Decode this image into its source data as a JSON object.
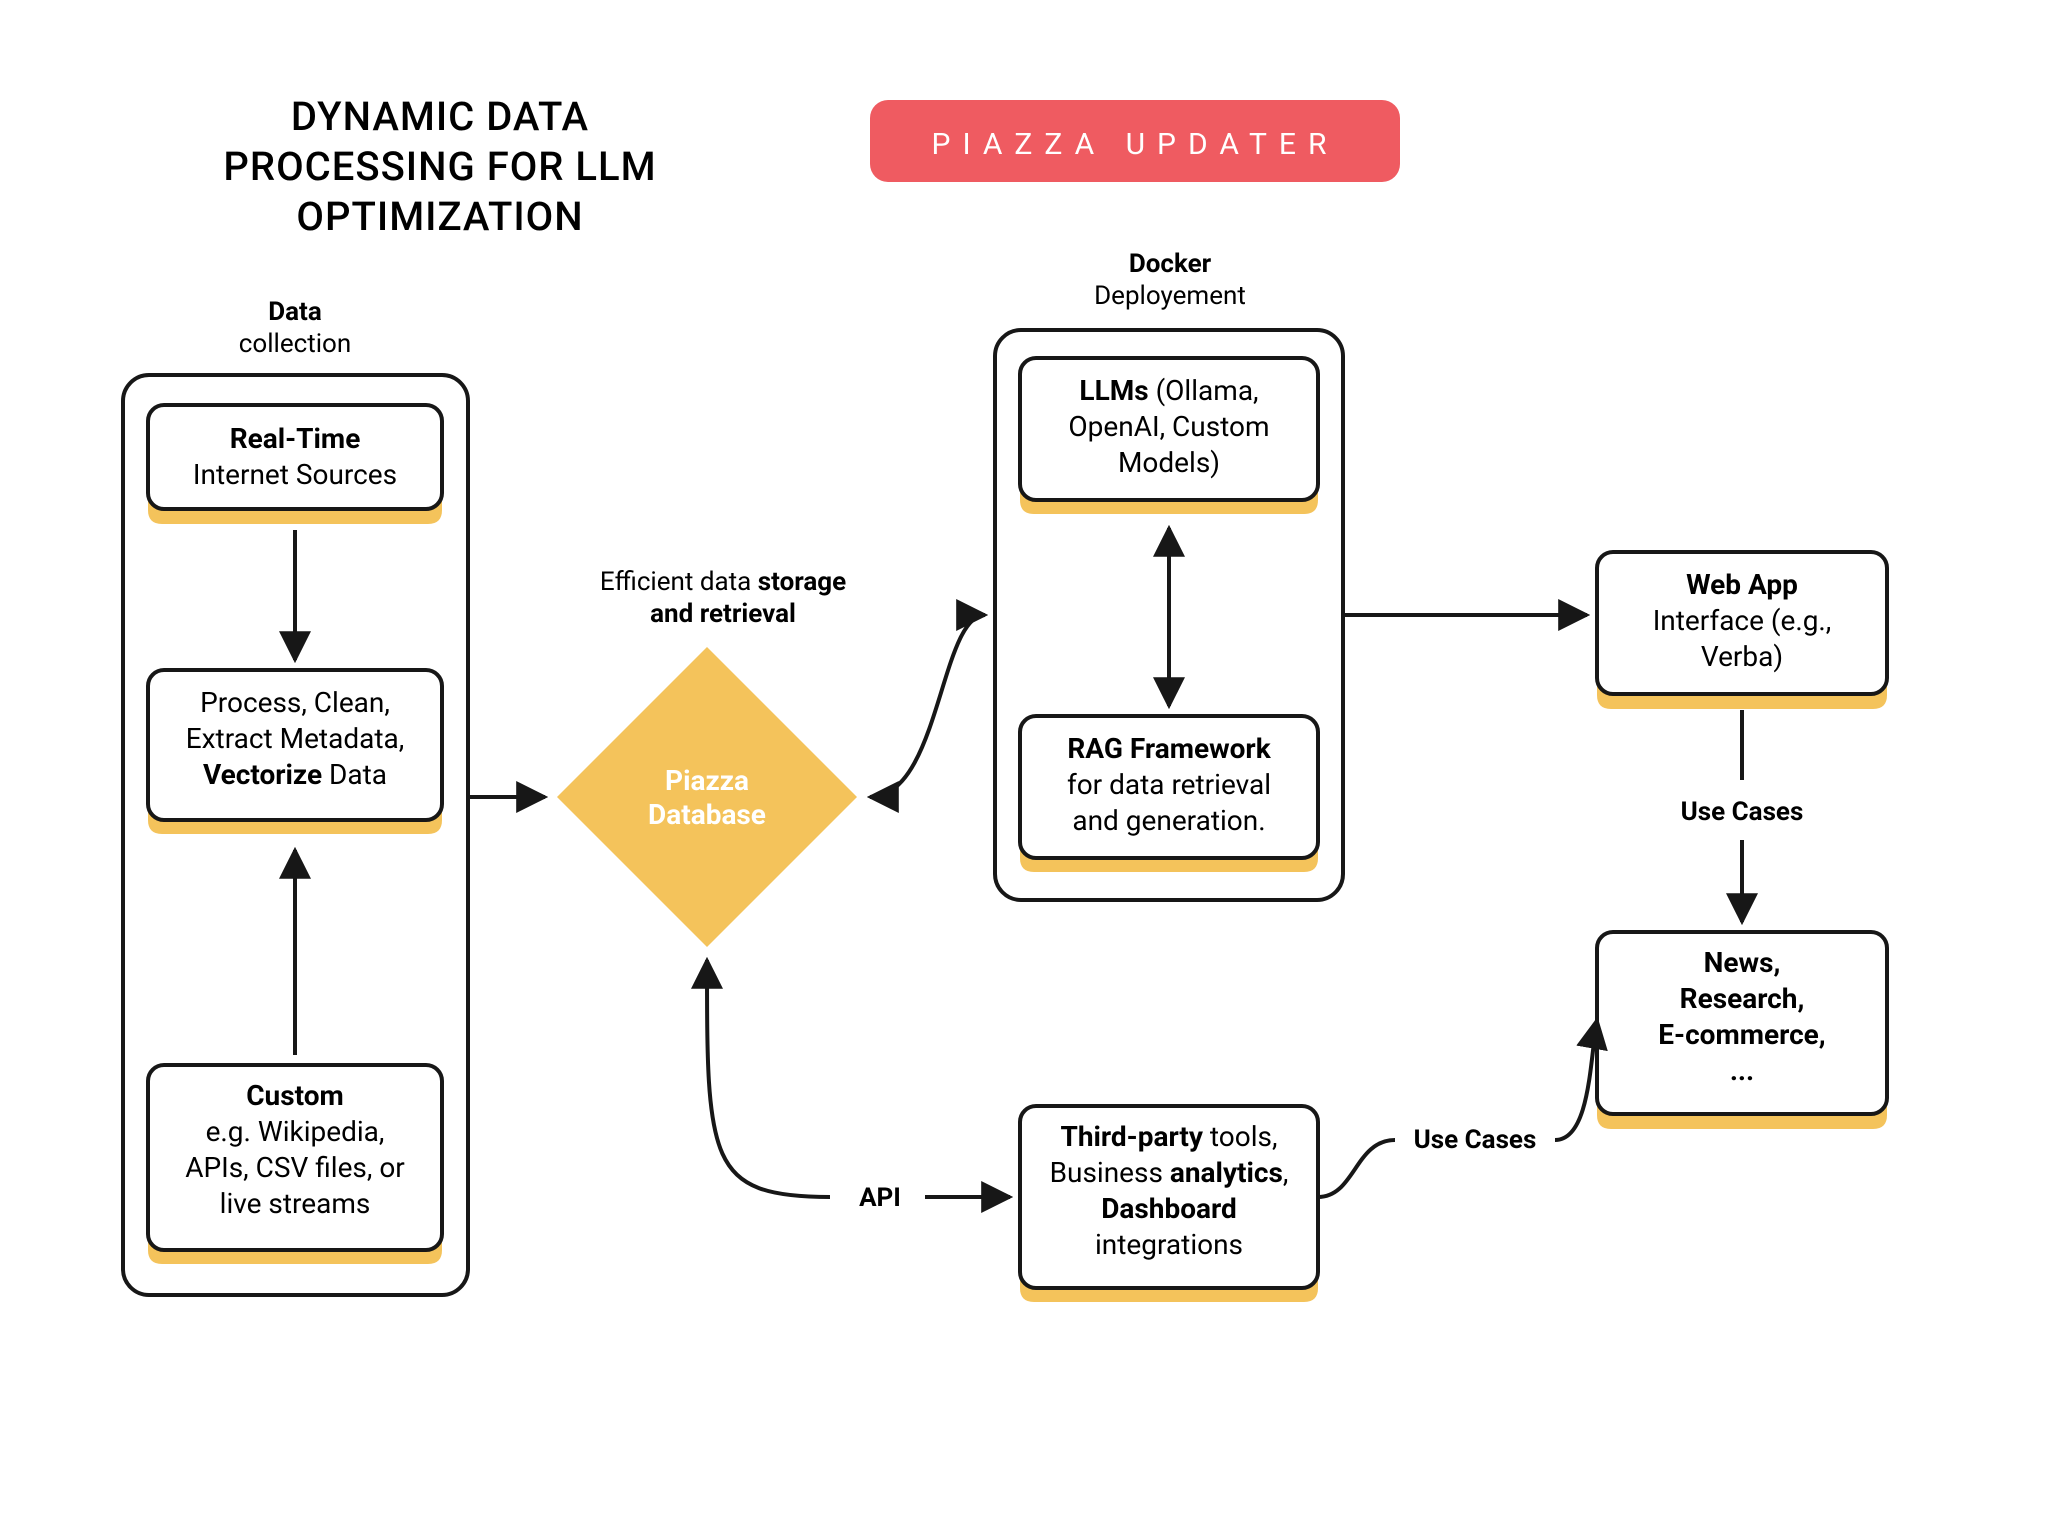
{
  "title_line1": "DYNAMIC DATA",
  "title_line2": "PROCESSING FOR LLM",
  "title_line3": "OPTIMIZATION",
  "badge": "PIAZZA UPDATER",
  "groups": {
    "data": {
      "bold": "Data",
      "regular": "collection"
    },
    "docker": {
      "bold": "Docker",
      "regular": "Deployement"
    }
  },
  "nodes": {
    "realtime": {
      "bold": "Real-Time",
      "rest": "Internet Sources"
    },
    "process": {
      "l1a": "Process,  Clean,",
      "l2a": "Extract Metadata,",
      "l3bold": "Vectorize",
      "l3rest": " Data"
    },
    "custom": {
      "bold": "Custom",
      "l2": "e.g. Wikipedia,",
      "l3": "APIs, CSV files, or",
      "l4": "live streams"
    },
    "llms": {
      "bold": "LLMs",
      "rest": " (Ollama,",
      "l2": "OpenAI, Custom",
      "l3": "Models)"
    },
    "rag": {
      "bold": "RAG Framework",
      "l2": "for data retrieval",
      "l3": "and generation."
    },
    "webapp": {
      "bold": "Web App",
      "l2": "Interface (e.g.,",
      "l3": "Verba)"
    },
    "thirdparty": {
      "l1bold1": "Third-party",
      "l1rest": " tools,",
      "l2a": "Business ",
      "l2bold": "analytics",
      "l2b": ",",
      "l3bold": "Dashboard",
      "l4": "integrations"
    },
    "usecases": {
      "l1": "News,",
      "l2": "Research,",
      "l3": "E-commerce,",
      "l4": "..."
    },
    "diamond": {
      "l1": "Piazza",
      "l2": "Database"
    }
  },
  "labels": {
    "storage1": "Efficient data ",
    "storage1b": "storage",
    "storage2b": "and retrieval",
    "api": "API",
    "uc1": "Use Cases",
    "uc2": "Use Cases"
  }
}
